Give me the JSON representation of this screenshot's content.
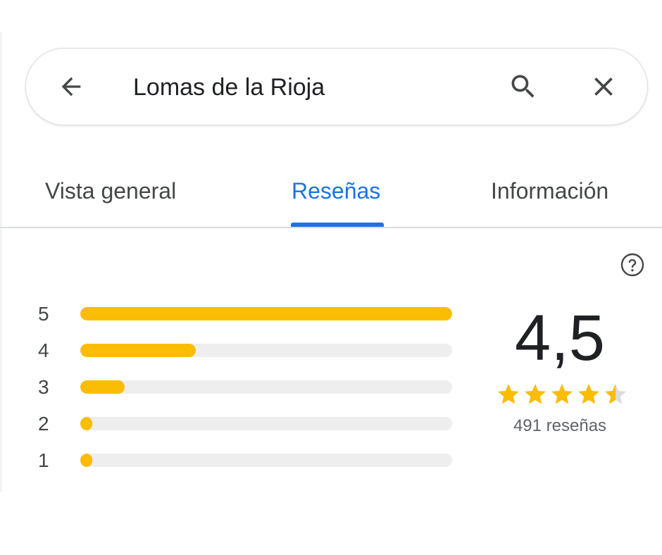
{
  "search": {
    "query": "Lomas de la Rioja",
    "back_icon": "arrow-left-icon",
    "search_icon": "search-icon",
    "clear_icon": "close-icon"
  },
  "tabs": [
    {
      "label": "Vista general",
      "active": false
    },
    {
      "label": "Reseñas",
      "active": true
    },
    {
      "label": "Información",
      "active": false
    }
  ],
  "reviews": {
    "help_icon": "help-circle-icon",
    "distribution": [
      {
        "stars": "5",
        "fraction": 1.0
      },
      {
        "stars": "4",
        "fraction": 0.31
      },
      {
        "stars": "3",
        "fraction": 0.12
      },
      {
        "stars": "2",
        "fraction": 0.02
      },
      {
        "stars": "1",
        "fraction": 0.02
      }
    ],
    "average": "4,5",
    "average_stars": 4.5,
    "count_text": "491 reseñas"
  },
  "colors": {
    "accent": "#1a73e8",
    "star": "#fbbc04",
    "track": "#eeeeee",
    "star_empty": "#dadce0"
  }
}
